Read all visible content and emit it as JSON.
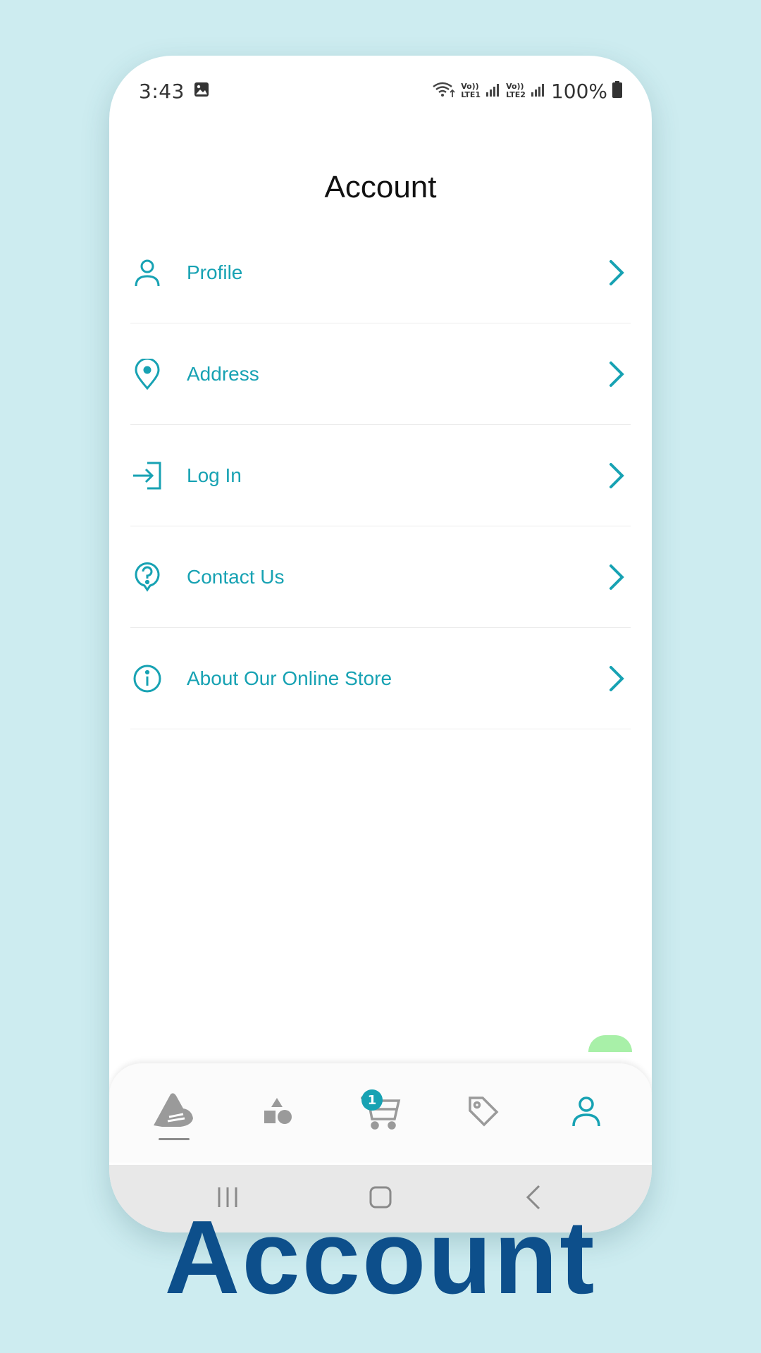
{
  "status_bar": {
    "time": "3:43",
    "net1": [
      "Vo))",
      "LTE1"
    ],
    "net2": [
      "Vo))",
      "LTE2"
    ],
    "battery": "100%"
  },
  "page": {
    "title": "Account"
  },
  "menu": [
    {
      "label": "Profile",
      "icon": "person-icon"
    },
    {
      "label": "Address",
      "icon": "location-pin-icon"
    },
    {
      "label": "Log In",
      "icon": "login-icon"
    },
    {
      "label": "Contact Us",
      "icon": "help-icon"
    },
    {
      "label": "About Our Online Store",
      "icon": "info-icon"
    }
  ],
  "bottom_nav": {
    "items": [
      "home-logo-icon",
      "categories-icon",
      "cart-icon",
      "tag-icon",
      "account-icon"
    ],
    "active": "account-icon",
    "cart_badge": "1"
  },
  "colors": {
    "accent": "#17a2b3",
    "background": "#cdecf0",
    "caption": "#0d4f8b",
    "inactive_icon": "#9a9a9a"
  },
  "caption": "Account"
}
